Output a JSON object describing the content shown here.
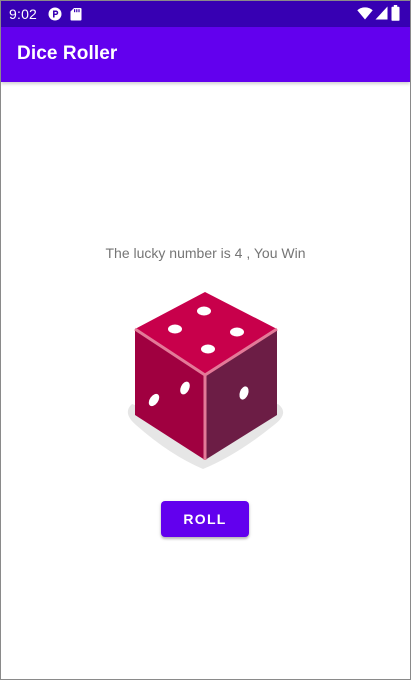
{
  "status_bar": {
    "time": "9:02",
    "icons": [
      "p-app-icon",
      "sd-card-icon",
      "wifi-icon",
      "cell-signal-icon",
      "battery-icon"
    ]
  },
  "app_bar": {
    "title": "Dice Roller"
  },
  "main": {
    "result_text": "The lucky number is 4 , You Win",
    "dice_value": 4,
    "roll_button_label": "ROLL"
  },
  "colors": {
    "status_bar": "#3700b3",
    "app_bar": "#6200ee",
    "button": "#6200ee",
    "dice_top": "#c8004b",
    "dice_left": "#a00040",
    "dice_right": "#6c1d45",
    "text_secondary": "#757575"
  }
}
